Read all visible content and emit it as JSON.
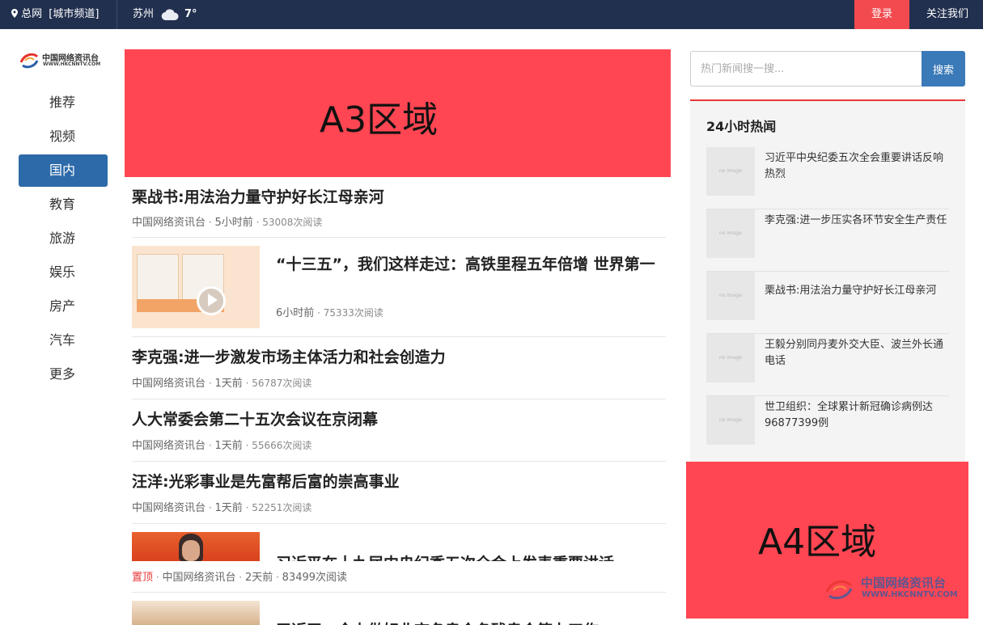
{
  "topbar": {
    "location": "总网",
    "city_channel": "[城市频道]",
    "city": "苏州",
    "temperature": "7°",
    "weather_icon": "cloud-icon",
    "login": "登录",
    "follow": "关注我们"
  },
  "logo": {
    "name_cn": "中国网络资讯台",
    "domain": "WWW.HKCNNTV.COM"
  },
  "nav": {
    "items": [
      {
        "label": "推荐"
      },
      {
        "label": "视频"
      },
      {
        "label": "国内",
        "active": true
      },
      {
        "label": "教育"
      },
      {
        "label": "旅游"
      },
      {
        "label": "娱乐"
      },
      {
        "label": "房产"
      },
      {
        "label": "汽车"
      },
      {
        "label": "更多"
      }
    ]
  },
  "ads": {
    "a3": "A3区域",
    "a4": "A4区域"
  },
  "articles": [
    {
      "title": "栗战书:用法治力量守护好长江母亲河",
      "source": "中国网络资讯台",
      "time": "5小时前",
      "reads": "53008次阅读"
    },
    {
      "title": "“十三五”，我们这样走过：高铁里程五年倍增 世界第一",
      "time": "6小时前",
      "reads": "75333次阅读"
    },
    {
      "title": "李克强:进一步激发市场主体活力和社会创造力",
      "source": "中国网络资讯台",
      "time": "1天前",
      "reads": "56787次阅读"
    },
    {
      "title": "人大常委会第二十五次会议在京闭幕",
      "source": "中国网络资讯台",
      "time": "1天前",
      "reads": "55666次阅读"
    },
    {
      "title": "汪洋:光彩事业是先富帮后富的崇高事业",
      "source": "中国网络资讯台",
      "time": "1天前",
      "reads": "52251次阅读"
    },
    {
      "title": "习近平在十九届中央纪委五次全会上发表重要讲话",
      "tag": "置顶",
      "source": "中国网络资讯台",
      "time": "2天前",
      "reads": "83499次阅读"
    },
    {
      "title": "习近平：全力做好北京冬奥会冬残奥会筹办工作"
    }
  ],
  "search": {
    "placeholder": "热门新闻搜一搜...",
    "button": "搜索"
  },
  "hot": {
    "title": "24小时热闻",
    "thumb_text": "no image",
    "items": [
      {
        "text": "习近平中央纪委五次全会重要讲话反响热烈"
      },
      {
        "text": "李克强:进一步压实各环节安全生产责任"
      },
      {
        "text": "栗战书:用法治力量守护好长江母亲河"
      },
      {
        "text": "王毅分别同丹麦外交大臣、波兰外长通电话"
      },
      {
        "text": "世卫组织：全球累计新冠确诊病例达96877399例"
      }
    ]
  },
  "colors": {
    "topbar": "#22304f",
    "accent_red": "#f24a4f",
    "ad_red": "#ff4652",
    "nav_active": "#2d6aa9",
    "search_button": "#3a7ab8"
  }
}
